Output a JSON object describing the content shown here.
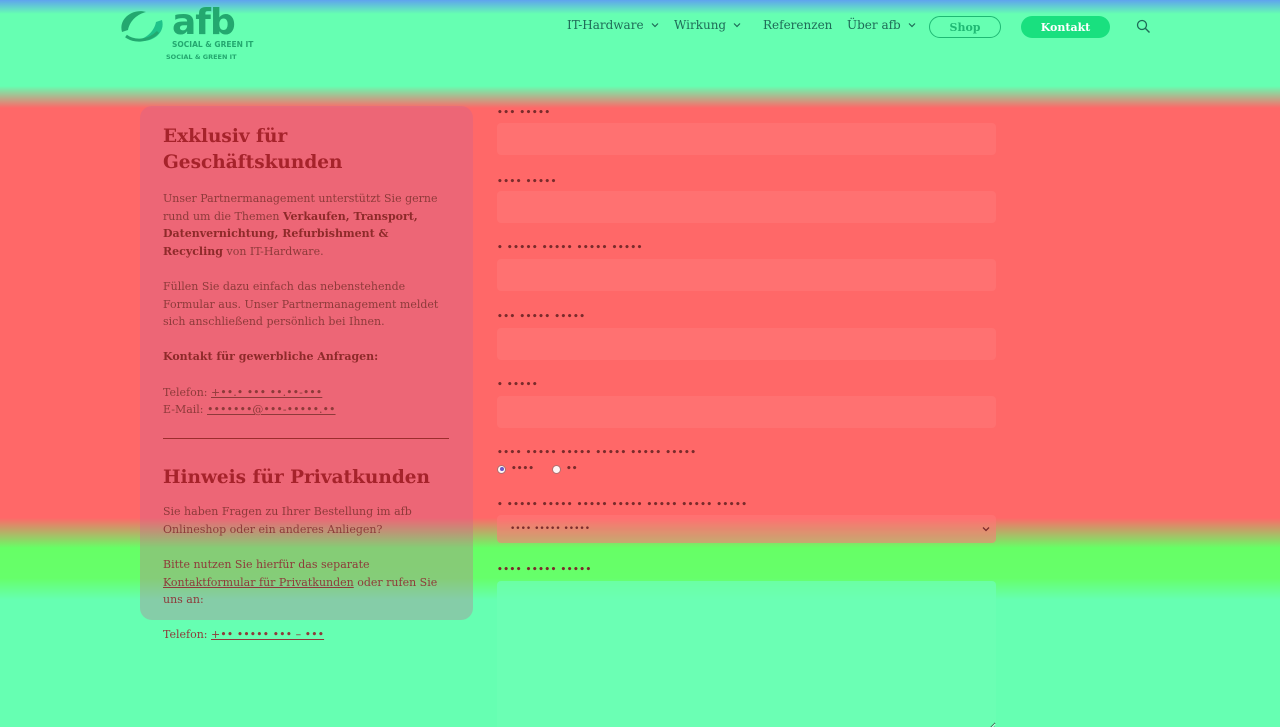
{
  "brand": {
    "wordmark": "afb",
    "tagline": "SOCIAL & GREEN IT",
    "tagline_small": "SOCIAL & GREEN IT"
  },
  "nav": {
    "items": [
      {
        "label": "IT-Hardware",
        "dropdown": true
      },
      {
        "label": "Wirkung",
        "dropdown": true
      },
      {
        "label": "Referenzen",
        "dropdown": false
      },
      {
        "label": "Über afb",
        "dropdown": true
      }
    ],
    "shop_label": "Shop",
    "kontakt_label": "Kontakt",
    "search_icon": "search-icon"
  },
  "info": {
    "business_title": "Exklusiv für Geschäftskunden",
    "intro_start": "Unser Partnermanagement unterstützt Sie gerne rund um die Themen ",
    "intro_bold": "Verkaufen, Transport, Datenvernichtung, Refurbishment & Recycling",
    "intro_end": " von IT-Hardware.",
    "form_hint": "Füllen Sie dazu einfach das nebenstehende Formular aus. Unser Partnermanagement meldet sich anschließend persönlich bei Ihnen.",
    "contact_heading": "Kontakt für gewerbliche Anfragen:",
    "phone_label": "Telefon:",
    "phone_value": "+••.• ••• ••.••-•••",
    "email_label": "E-Mail:",
    "email_value": "•••••••@•••-•••••.••",
    "private_title": "Hinweis für Privatkunden",
    "private_q": "Sie haben Fragen zu Ihrer Bestellung im afb Onlineshop oder ein anderes Anliegen?",
    "private_use_start": "Bitte nutzen Sie hierfür das separate ",
    "private_link": "Kontaktformular für Privatkunden",
    "private_use_end": " oder rufen Sie uns an:",
    "private_phone_label": "Telefon:",
    "private_phone_value": "+•• ••••• ••• – •••"
  },
  "form": {
    "label_1": "••• •••••",
    "label_2": "•••• •••••",
    "label_3": "• ••••• ••••• ••••• •••••",
    "label_4": "••• ••••• •••••",
    "label_5": "• •••••",
    "label_6": "•••• ••••• ••••• ••••• ••••• •••••",
    "radio_1": "••••",
    "radio_2": "••",
    "label_7": "• ••••• ••••• ••••• ••••• ••••• ••••• •••••",
    "select_value": "•••• ••••• •••••",
    "label_8": "•••• ••••• •••••"
  },
  "colors": {
    "brand_green": "#23a86f",
    "button_green": "#19e07f",
    "heading_red": "#a6232b"
  }
}
